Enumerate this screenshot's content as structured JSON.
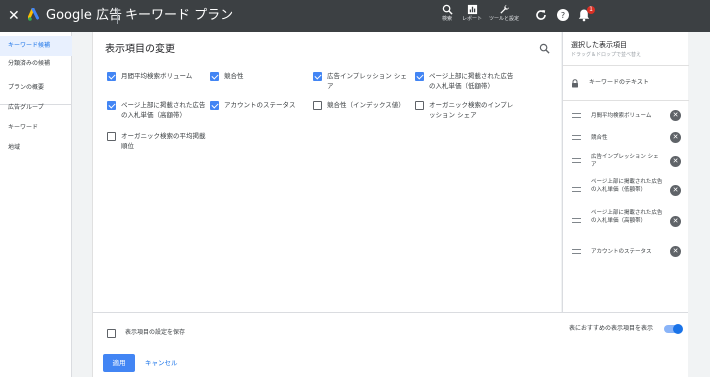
{
  "topbar": {
    "close_icon": "close-icon",
    "brand": "Google 広告",
    "tool_name": "キーワード プラン",
    "actions": [
      {
        "icon": "search-icon",
        "label": "検索"
      },
      {
        "icon": "report-icon",
        "label": "レポート"
      },
      {
        "icon": "wrench-icon",
        "label": "ツールと設定"
      }
    ],
    "notification_count": "1"
  },
  "sidebar": {
    "items": [
      {
        "label": "キーワード候補"
      },
      {
        "label": "分類済みの候補"
      },
      {
        "label": "プランの概要"
      },
      {
        "label": "広告グループ"
      },
      {
        "label": "キーワード"
      },
      {
        "label": "地域"
      }
    ]
  },
  "main": {
    "title": "表示項目の変更",
    "options": [
      {
        "label": "月間平均検索ボリューム",
        "checked": true
      },
      {
        "label": "競合性",
        "checked": true
      },
      {
        "label": "広告インプレッション シェア",
        "checked": true
      },
      {
        "label": "ページ上部に掲載された広告の入札単価（低額帯）",
        "checked": true
      },
      {
        "label": "ページ上部に掲載された広告の入札単価（高額帯）",
        "checked": true
      },
      {
        "label": "アカウントのステータス",
        "checked": true
      },
      {
        "label": "競合性（インデックス値）",
        "checked": false
      },
      {
        "label": "オーガニック検索のインプレッション シェア",
        "checked": false
      },
      {
        "label": "オーガニック検索の平均掲載順位",
        "checked": false
      }
    ]
  },
  "selected": {
    "title": "選択した表示項目",
    "subtitle": "ドラッグ＆ドロップで並べ替え",
    "fixed_label": "キーワードのテキスト",
    "items": [
      {
        "label": "月間平均検索ボリューム"
      },
      {
        "label": "競合性"
      },
      {
        "label": "広告インプレッション シェア"
      },
      {
        "label": "ページ上部に掲載された広告の入札単価（低額帯）"
      },
      {
        "label": "ページ上部に掲載された広告の入札単価（高額帯）"
      },
      {
        "label": "アカウントのステータス"
      }
    ]
  },
  "footer": {
    "save_label": "表示項目の設定を保存",
    "save_checked": false,
    "recommended_label": "表におすすめの表示項目を表示",
    "recommended_on": true,
    "apply_label": "適用",
    "cancel_label": "キャンセル"
  },
  "colors": {
    "topbar": "#3c4043",
    "accent": "#1a73e8",
    "checkbox": "#4285f4",
    "badge": "#d93025"
  }
}
